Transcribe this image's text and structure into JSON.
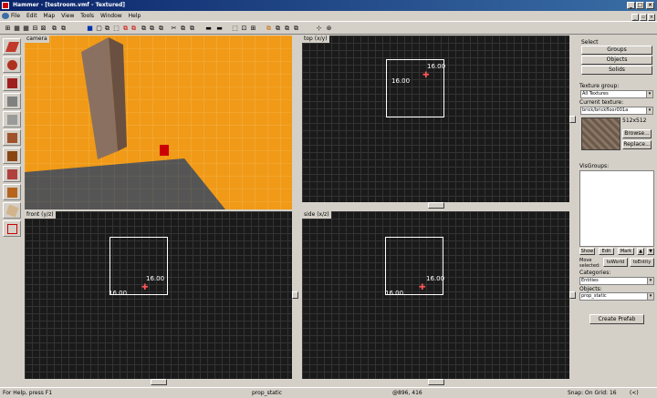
{
  "window": {
    "title": "Hammer - [testroom.vmf - Textured]"
  },
  "menu": [
    "File",
    "Edit",
    "Map",
    "View",
    "Tools",
    "Window",
    "Help"
  ],
  "viewports": {
    "camera": {
      "label": "camera"
    },
    "top": {
      "label": "top (x/y)",
      "dim_a": "16.00",
      "dim_b": "16.00"
    },
    "front": {
      "label": "front (y/z)",
      "dim_a": "16.00",
      "dim_b": "16.00"
    },
    "side": {
      "label": "side (x/z)",
      "dim_a": "16.00",
      "dim_b": "16.00"
    }
  },
  "panel": {
    "select_label": "Select",
    "groups": "Groups",
    "objects": "Objects",
    "solids": "Solids",
    "texture_group_label": "Texture group:",
    "texture_group_value": "All Textures",
    "current_texture_label": "Current texture:",
    "current_texture_value": "brick/brickfloor001a",
    "texture_size": "512x512",
    "browse": "Browse...",
    "replace": "Replace...",
    "visgroups_label": "VisGroups:",
    "show": "Show",
    "edit": "Edit",
    "mark": "Mark",
    "move_selected": "Move selected:",
    "to_world": "toWorld",
    "to_entity": "toEntity",
    "categories_label": "Categories:",
    "categories_value": "Entities",
    "objects_label": "Objects:",
    "objects_value": "prop_static",
    "create_prefab": "Create Prefab"
  },
  "status": {
    "help": "For Help, press F1",
    "selection": "prop_static",
    "coords": "@896, 416",
    "snap": "Snap: On Grid: 16",
    "zoom": "(<)"
  }
}
